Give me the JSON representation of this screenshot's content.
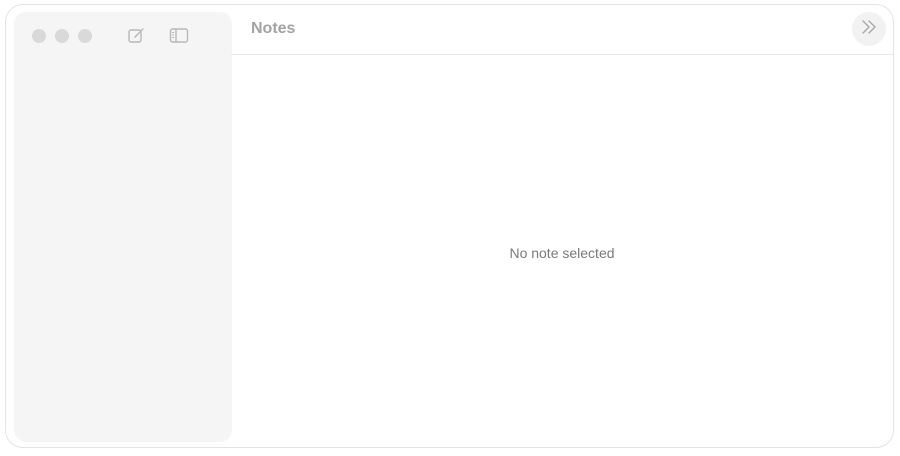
{
  "window": {
    "controls": [
      "close",
      "minimize",
      "maximize"
    ],
    "traffic_light_color": "#d9d9d9"
  },
  "sidebar": {
    "tools": [
      {
        "icon": "compose-icon"
      },
      {
        "icon": "sidebar-toggle-icon"
      }
    ],
    "background": "#f5f5f5"
  },
  "header": {
    "title": "Notes",
    "expand_icon": "double-chevron-right-icon"
  },
  "main": {
    "empty_message": "No note selected"
  }
}
